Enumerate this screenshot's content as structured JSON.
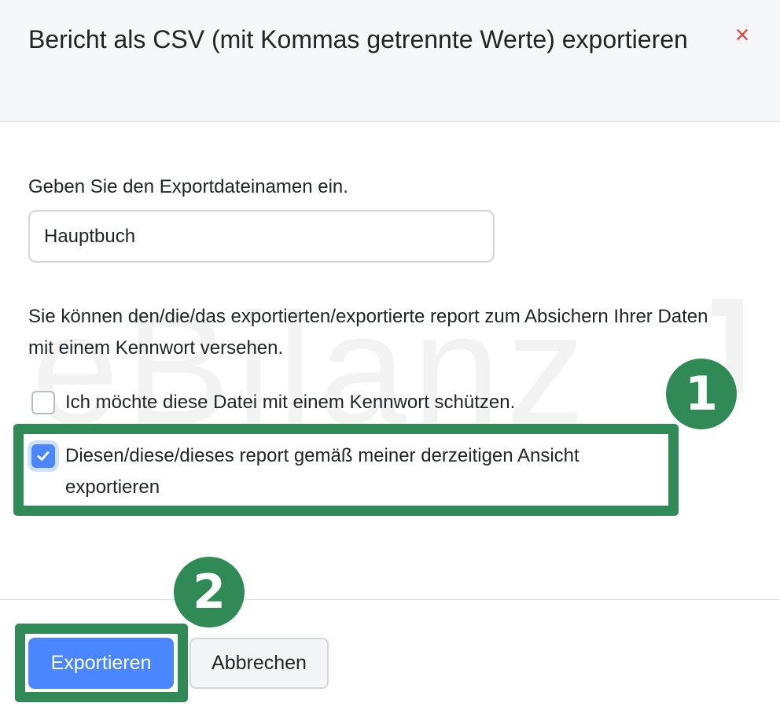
{
  "dialog": {
    "title": "Bericht als CSV (mit Kommas getrennte Werte) exportieren",
    "close_icon": "×"
  },
  "watermark": {
    "text": "eBilanz"
  },
  "form": {
    "filename_label": "Geben Sie den Exportdateinamen ein.",
    "filename_value": "Hauptbuch",
    "info_text": "Sie können den/die/das exportierten/exportierte report zum Absichern Ihrer Daten mit einem Kennwort versehen.",
    "password_checkbox": {
      "label": "Ich möchte diese Datei mit einem Kennwort schützen.",
      "checked": false
    },
    "current_view_checkbox": {
      "label": "Diesen/diese/dieses report gemäß meiner derzeitigen Ansicht exportieren",
      "checked": true
    }
  },
  "annotations": {
    "badge_1": "1",
    "badge_2": "2",
    "highlight_color": "#2f8a55"
  },
  "footer": {
    "export_label": "Exportieren",
    "cancel_label": "Abbrechen"
  },
  "colors": {
    "primary": "#4a86ff",
    "close": "#e0463c",
    "header_bg": "#f6f7f8"
  }
}
